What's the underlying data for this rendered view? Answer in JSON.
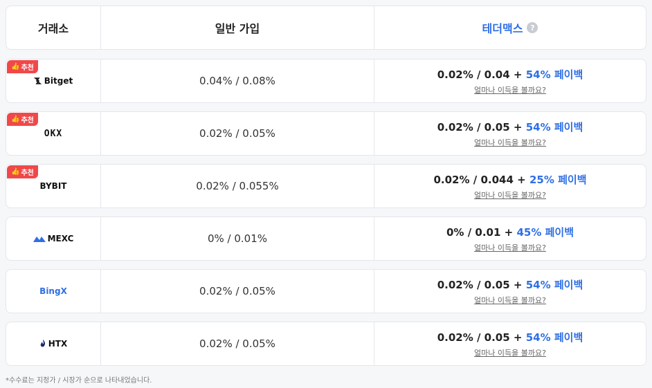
{
  "header": {
    "exchange_label": "거래소",
    "normal_label": "일반 가입",
    "tethermax_label": "테더맥스",
    "help_icon": "?"
  },
  "recommend_label": "추천",
  "calc_link": "얼마나 이득을 볼까요?",
  "plus": "+",
  "payback_suffix": "페이백",
  "rows": [
    {
      "exchange": "Bitget",
      "recommended": true,
      "normal_fee": "0.04% / 0.08%",
      "tm_fee": "0.02% / 0.04",
      "payback": "54%"
    },
    {
      "exchange": "OKX",
      "recommended": true,
      "normal_fee": "0.02% / 0.05%",
      "tm_fee": "0.02% / 0.05",
      "payback": "54%"
    },
    {
      "exchange": "BYBIT",
      "recommended": true,
      "normal_fee": "0.02% / 0.055%",
      "tm_fee": "0.02% / 0.044",
      "payback": "25%"
    },
    {
      "exchange": "MEXC",
      "recommended": false,
      "normal_fee": "0% / 0.01%",
      "tm_fee": "0% / 0.01",
      "payback": "45%"
    },
    {
      "exchange": "BingX",
      "recommended": false,
      "normal_fee": "0.02% / 0.05%",
      "tm_fee": "0.02% / 0.05",
      "payback": "54%"
    },
    {
      "exchange": "HTX",
      "recommended": false,
      "normal_fee": "0.02% / 0.05%",
      "tm_fee": "0.02% / 0.05",
      "payback": "54%"
    }
  ],
  "footnote": "*수수료는 지정가 / 시장가 순으로 나타내었습니다.",
  "colors": {
    "accent": "#2f6fe4",
    "badge": "#f0484a",
    "border": "#e3e6eb"
  }
}
